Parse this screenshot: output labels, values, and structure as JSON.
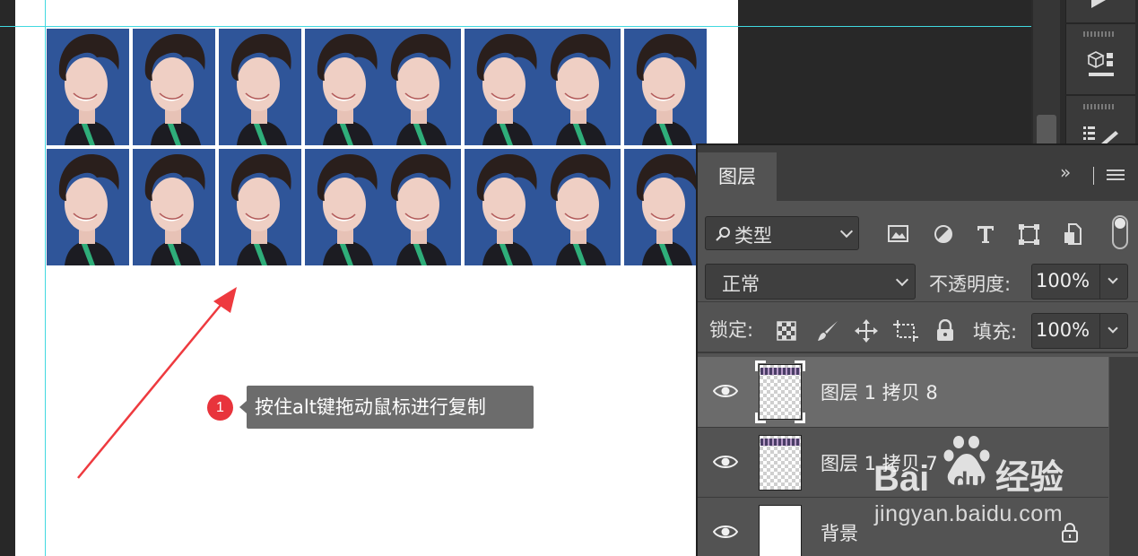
{
  "annotation": {
    "step_number": "1",
    "text": "按住alt键拖动鼠标进行复制"
  },
  "layers_panel": {
    "tab_label": "图层",
    "expand_icon_text": "»",
    "filter": {
      "kind_label": "类型",
      "filter_icons": [
        "image-filter-icon",
        "adjustment-filter-icon",
        "type-filter-icon",
        "shape-filter-icon",
        "smart-object-filter-icon"
      ]
    },
    "blend_mode": "正常",
    "opacity_label": "不透明度:",
    "opacity_value": "100%",
    "lock_label": "锁定:",
    "lock_icons": [
      "lock-transparent-icon",
      "lock-paint-icon",
      "lock-position-icon",
      "lock-artboard-icon",
      "lock-all-icon"
    ],
    "fill_label": "填充:",
    "fill_value": "100%",
    "layers": [
      {
        "name": "图层 1 拷贝 8",
        "selected": true,
        "thumbnail": "transparent"
      },
      {
        "name": "图层 1 拷贝 7",
        "selected": false,
        "thumbnail": "transparent"
      },
      {
        "name": "背景",
        "selected": false,
        "thumbnail": "white",
        "locked": true
      }
    ]
  },
  "canvas": {
    "photo_grid": {
      "rows": 2,
      "columns": 8
    },
    "photo_bg_color": "#2f5599",
    "guide_color": "#41d9e0"
  },
  "watermark": {
    "logo_text": "Bai",
    "logo_text2": "du",
    "logo_cn": "经验",
    "url": "jingyan.baidu.com"
  }
}
